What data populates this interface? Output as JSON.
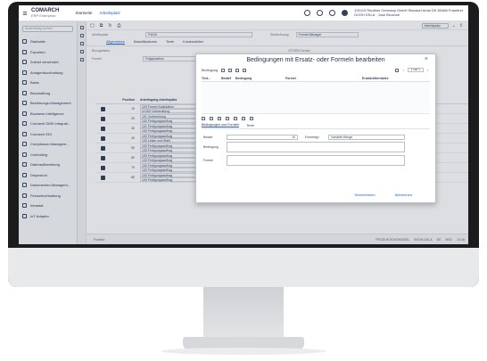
{
  "app": {
    "brand": "COMARCH",
    "brand_sub": "ERP Enterprise"
  },
  "header": {
    "tabs": [
      "Startseite",
      "Arbeitsplatz"
    ],
    "company": "100113 Rauthes Germany GmbH Standort Amst DE-60486 Frankfurt",
    "company_sub": "DOSH DSLA · Jose Bruchon"
  },
  "sidebar": {
    "search_placeholder": "Anwendung suchen",
    "items": [
      "Startseite",
      "Favoriten",
      "Zuletzt verwendet",
      "Anlagenbuchhaltung",
      "Basis",
      "Beschaffung",
      "Beziehungs-Management",
      "Business Intelligence",
      "Comarch DMS Integrati...",
      "Comarch EDI",
      "Compliance-Managem...",
      "Controlling",
      "Datenaufbereitung",
      "Dispostool",
      "Dokumenten-Managem...",
      "Finanzbuchhaltung",
      "Intrastat",
      "IoT-Adapter"
    ]
  },
  "main": {
    "toolbar_right": "Arbeitsplatz",
    "field1_label": "Arbeitsplatz",
    "field1_value": "F4010",
    "field2_label": "Bezeichnung",
    "field2_value": "Formel-Manager",
    "tabs": [
      "Allgemeines",
      "Klassifikationen",
      "Texte",
      "Kostenstellen"
    ],
    "field3_label": "Bezugsfaktor",
    "field4_label": "Formel",
    "field4_value": "Folgeposition",
    "field5_value": "ETGRS Formel",
    "grid_headers": [
      "Position",
      "Text...",
      "Arbeitsgang Arbeitsplatz",
      "",
      "Gültig ab",
      "Aktuel..."
    ],
    "grid_subheader": "Primär Ressource",
    "rows": [
      {
        "pos": "10",
        "l1": "100 Formel Kalkulation",
        "l2": "UI 600 Vorbereitung",
        "date1": "09.01.2020",
        "date2": "31.12.9999"
      },
      {
        "pos": "20",
        "l1": "101 Vorbereitung",
        "l2": "100 Fertigungsauftrag",
        "date1": "09.01.2020",
        "date2": "31.12.9999"
      },
      {
        "pos": "30",
        "l1": "101 Fertigungsauftrag",
        "l2": "100 Fertigungsauftrag",
        "date1": "09.01.2020",
        "date2": "31.12.9999"
      },
      {
        "pos": "40",
        "l1": "100 Fertigungsauftrag",
        "l2": "100 Leiste und Stahl",
        "date1": "09.01.2020",
        "date2": "31.12.9999"
      },
      {
        "pos": "50",
        "l1": "100 Fertigungsauftrag",
        "l2": "100 Fertigungsauftrag",
        "date1": "09.01.2020",
        "date2": "31.12.9999"
      },
      {
        "pos": "60",
        "l1": "100 Fertigungsauftrag",
        "l2": "100 Fertigungsauftrag",
        "date1": "09.01.2020",
        "date2": "31.12.9999"
      },
      {
        "pos": "70",
        "l1": "100 Fertigungsauftrag",
        "l2": "100 Fertigungsauftrag",
        "date1": "09.01.2020",
        "date2": "31.12.9999"
      },
      {
        "pos": "80",
        "l1": "100 Fertigungsauftrag",
        "l2": "100 Fertigungsauftrag",
        "date1": "09.01.2020",
        "date2": "31.12.9999"
      }
    ],
    "status_left": "Position",
    "status_right": [
      "PRODUKTIONSMODEL",
      "BOSH-DSLA",
      "DE",
      "MSC",
      "13:26"
    ]
  },
  "modal": {
    "title": "Bedingungen mit Ersatz- oder Formeln bearbeiten",
    "toolbar_label": "Bedingung",
    "pager": "1 von 1",
    "headers": [
      "Text...",
      "Bedarf",
      "Bedingung",
      "Formel",
      "Ersatz/Alternative"
    ],
    "tabs": [
      "Bedingungen und Formeln",
      "Texte"
    ],
    "form": {
      "bedarf_label": "Bedarf",
      "bedarf_value": "10",
      "formeltyp_label": "Formeltyp",
      "formeltyp_value": "Variable Menge",
      "bedingung_label": "Bedingung",
      "formel_label": "Formel"
    },
    "ok_label": "Übernehmen",
    "cancel_label": "Abbrechen"
  }
}
